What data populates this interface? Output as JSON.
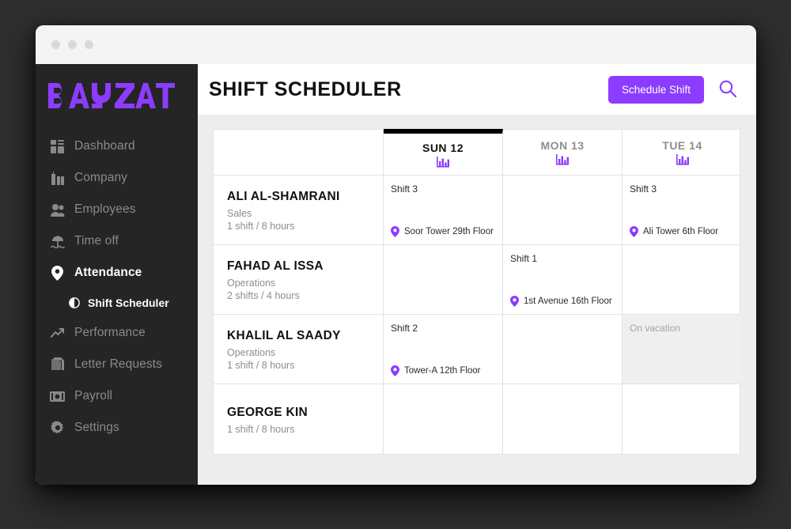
{
  "window": {
    "traffic_dots": [
      "dot-1",
      "dot-2",
      "dot-3"
    ]
  },
  "brand": {
    "logo_text": "BAYZAT",
    "accent_color": "#8c3cff",
    "sidebar_bg": "#252525"
  },
  "sidebar": {
    "items": [
      {
        "label": "Dashboard",
        "icon": "dashboard-icon",
        "active": false
      },
      {
        "label": "Company",
        "icon": "company-icon",
        "active": false
      },
      {
        "label": "Employees",
        "icon": "employees-icon",
        "active": false
      },
      {
        "label": "Time off",
        "icon": "time-off-icon",
        "active": false
      },
      {
        "label": "Attendance",
        "icon": "location-pin-icon",
        "active": true
      },
      {
        "label": "Performance",
        "icon": "performance-icon",
        "active": false
      },
      {
        "label": "Letter Requests",
        "icon": "letter-requests-icon",
        "active": false
      },
      {
        "label": "Payroll",
        "icon": "payroll-icon",
        "active": false
      },
      {
        "label": "Settings",
        "icon": "gear-icon",
        "active": false
      }
    ],
    "sub_item": {
      "label": "Shift Scheduler",
      "icon": "half-circle-icon",
      "active": true
    }
  },
  "header": {
    "title": "SHIFT SCHEDULER",
    "schedule_button": "Schedule Shift",
    "search_icon": "search-icon"
  },
  "scheduler": {
    "days": [
      {
        "label": "SUN 12",
        "today": true,
        "chart_icon": "bar-chart-icon"
      },
      {
        "label": "MON 13",
        "today": false,
        "chart_icon": "bar-chart-icon"
      },
      {
        "label": "TUE 14",
        "today": false,
        "chart_icon": "bar-chart-icon"
      }
    ],
    "rows": [
      {
        "name": "ALI AL-SHAMRANI",
        "department": "Sales",
        "hours": "1 shift / 8 hours",
        "cells": [
          {
            "shift": "Shift 3",
            "location": "Soor Tower 29th Floor",
            "vacation": false
          },
          {
            "shift": "",
            "location": "",
            "vacation": false
          },
          {
            "shift": "Shift 3",
            "location": "Ali Tower 6th Floor",
            "vacation": false
          }
        ]
      },
      {
        "name": "FAHAD AL ISSA",
        "department": "Operations",
        "hours": "2 shifts / 4 hours",
        "cells": [
          {
            "shift": "",
            "location": "",
            "vacation": false
          },
          {
            "shift": "Shift 1",
            "location": "1st Avenue 16th Floor",
            "vacation": false
          },
          {
            "shift": "",
            "location": "",
            "vacation": false
          }
        ]
      },
      {
        "name": "KHALIL AL SAADY",
        "department": "Operations",
        "hours": "1 shift / 8 hours",
        "cells": [
          {
            "shift": "Shift 2",
            "location": "Tower-A 12th Floor",
            "vacation": false
          },
          {
            "shift": "",
            "location": "",
            "vacation": false
          },
          {
            "shift": "",
            "location": "",
            "vacation": true,
            "vacation_label": "On vacation"
          }
        ]
      },
      {
        "name": "GEORGE KIN",
        "department": "",
        "hours": "1 shift / 8 hours",
        "cells": [
          {
            "shift": "",
            "location": "",
            "vacation": false
          },
          {
            "shift": "",
            "location": "",
            "vacation": false
          },
          {
            "shift": "",
            "location": "",
            "vacation": false
          }
        ]
      }
    ]
  }
}
